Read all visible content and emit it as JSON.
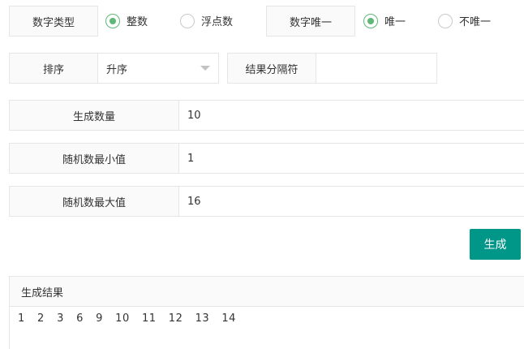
{
  "number_type": {
    "label": "数字类型",
    "options": [
      "整数",
      "浮点数"
    ],
    "selected": "整数"
  },
  "unique": {
    "label": "数字唯一",
    "options": [
      "唯一",
      "不唯一"
    ],
    "selected": "唯一"
  },
  "sort": {
    "label": "排序",
    "value": "升序"
  },
  "separator": {
    "label": "结果分隔符",
    "value": ""
  },
  "count": {
    "label": "生成数量",
    "value": "10"
  },
  "min": {
    "label": "随机数最小值",
    "value": "1"
  },
  "max": {
    "label": "随机数最大值",
    "value": "16"
  },
  "generate_button": {
    "label": "生成"
  },
  "result": {
    "title": "生成结果",
    "text": "1  2  3  6  9  10  11  12  13  14"
  },
  "colors": {
    "accent": "#009688",
    "radio": "#5fb878",
    "border": "#e6e6e6",
    "label_bg": "#fafafa"
  }
}
